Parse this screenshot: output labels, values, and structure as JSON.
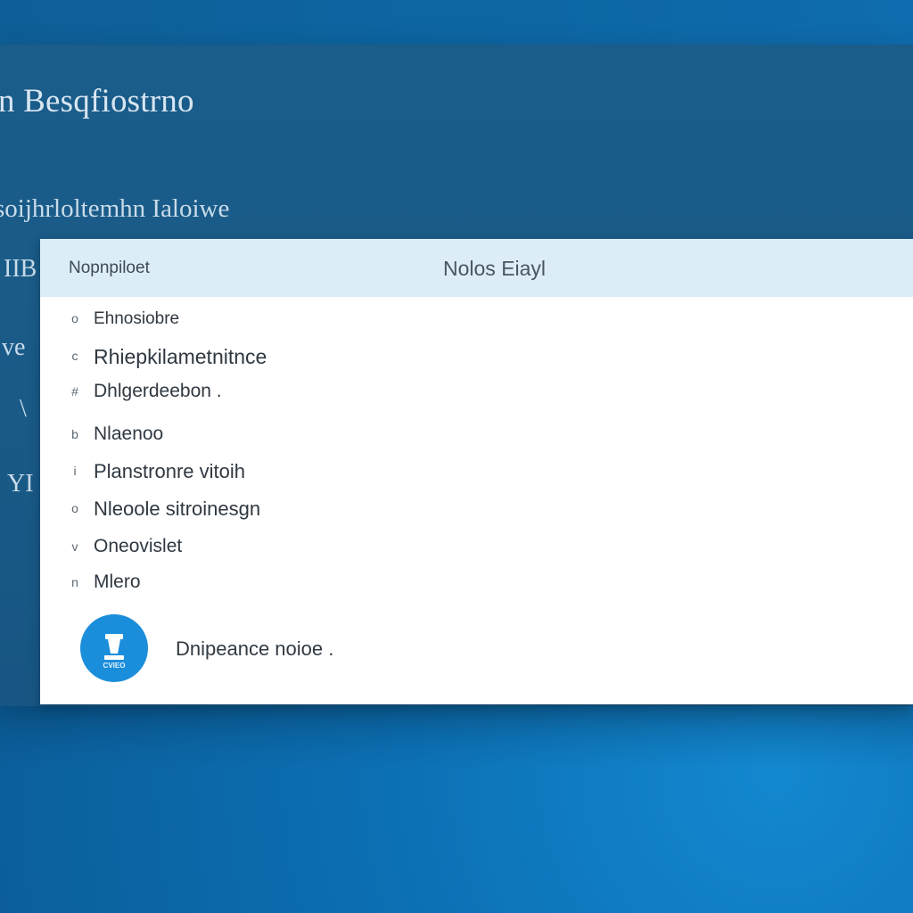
{
  "window": {
    "title": "n Besqfiostrno",
    "subtitle": "soijhrloltemhn Ialoiwe"
  },
  "sidebar": {
    "glyphs": [
      "IIB",
      "ve",
      "\\",
      "YI"
    ]
  },
  "table": {
    "headers": {
      "left": "Nopnpiloet",
      "right": "Nolos Eiayl"
    },
    "items": [
      {
        "bullet": "o",
        "label": "Ehnosiobre"
      },
      {
        "bullet": "c",
        "label": "Rhiepkilametnitnce"
      },
      {
        "bullet": "#",
        "label": "Dhlgerdeebon ."
      },
      {
        "bullet": "b",
        "label": "Nlaenoo"
      },
      {
        "bullet": "i",
        "label": "Planstronre vitoih"
      },
      {
        "bullet": "o",
        "label": "Nleoole sitroinesgn"
      },
      {
        "bullet": "v",
        "label": "Oneovislet"
      },
      {
        "bullet": "n",
        "label": "Mlero"
      }
    ]
  },
  "footer": {
    "badge_icon": "user-badge-icon",
    "badge_text": "CVIEO",
    "label": "Dnipeance noioe ."
  },
  "colors": {
    "accent": "#1b8edb",
    "header_bg": "#dcedf8",
    "window_bg": "#1a5c8a"
  }
}
